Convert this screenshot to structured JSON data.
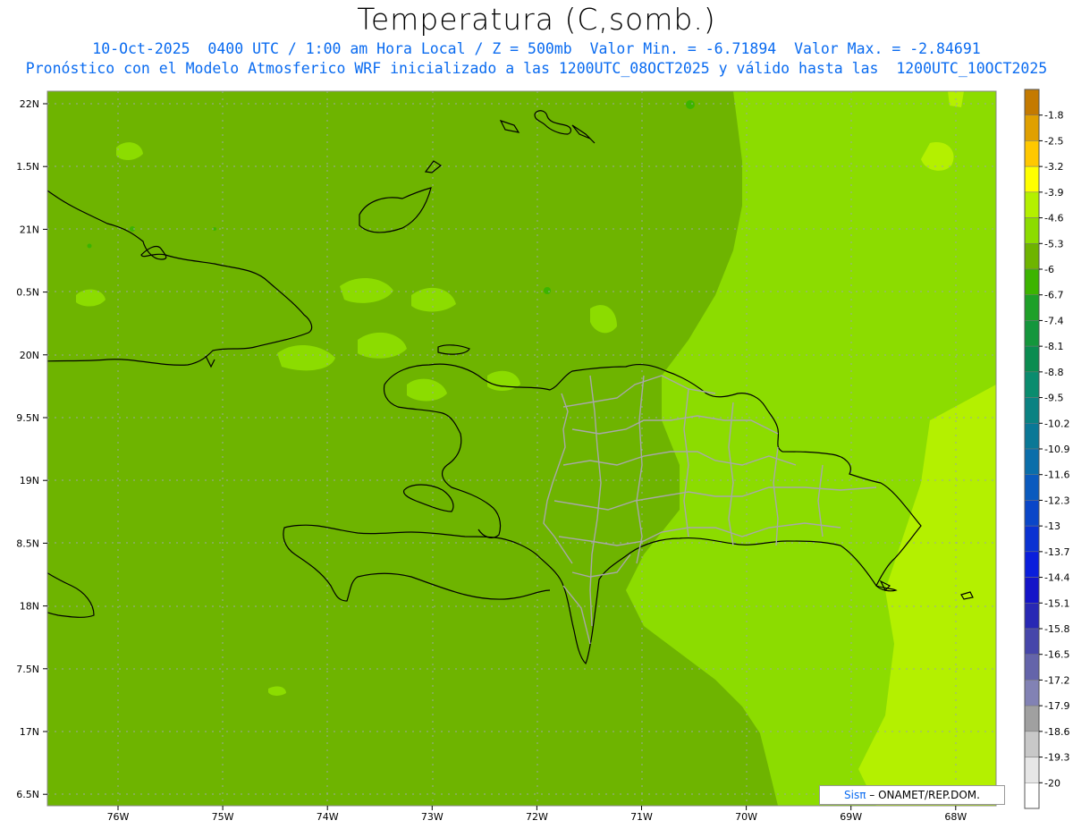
{
  "title": "Temperatura (C,somb.)",
  "subtitle_line1": "10-Oct-2025  0400 UTC / 1:00 am Hora Local / Z = 500mb  Valor Min. = -6.71894  Valor Max. = -2.84691",
  "subtitle_line2": "Pronóstico con el Modelo Atmosferico WRF inicializado a las 1200UTC_08OCT2025 y válido hasta las  1200UTC_10OCT2025",
  "lat_labels": [
    "22N",
    "1.5N",
    "21N",
    "0.5N",
    "20N",
    "9.5N",
    "19N",
    "8.5N",
    "18N",
    "7.5N",
    "17N",
    "6.5N"
  ],
  "lon_labels": [
    "76W",
    "75W",
    "74W",
    "73W",
    "72W",
    "71W",
    "70W",
    "69W",
    "68W"
  ],
  "colorbar": {
    "labels": [
      "-1.8",
      "-2.5",
      "-3.2",
      "-3.9",
      "-4.6",
      "-5.3",
      "-6",
      "-6.7",
      "-7.4",
      "-8.1",
      "-8.8",
      "-9.5",
      "-10.2",
      "-10.9",
      "-11.6",
      "-12.3",
      "-13",
      "-13.7",
      "-14.4",
      "-15.1",
      "-15.8",
      "-16.5",
      "-17.2",
      "-17.9",
      "-18.6",
      "-19.3",
      "-20"
    ],
    "colors": [
      "#c47a00",
      "#e0a000",
      "#ffc800",
      "#ffff00",
      "#b4f000",
      "#8cdc00",
      "#6eb400",
      "#3cb400",
      "#1ea028",
      "#14963c",
      "#0a8c50",
      "#0a8c6e",
      "#0a8282",
      "#0a7896",
      "#0a6eaa",
      "#0a5abe",
      "#0a46c8",
      "#0a32d2",
      "#0a1edc",
      "#1414c8",
      "#2828b4",
      "#4646aa",
      "#6464aa",
      "#8282b4",
      "#a0a0a0",
      "#c8c8c8",
      "#e6e6e6",
      "#ffffff"
    ]
  },
  "credit": {
    "brand": "Sisπ",
    "text": " – ONAMET/REP.DOM."
  },
  "field_colors": {
    "base": "#6eb400",
    "light": "#8cdc00",
    "lighter": "#b4f000"
  }
}
